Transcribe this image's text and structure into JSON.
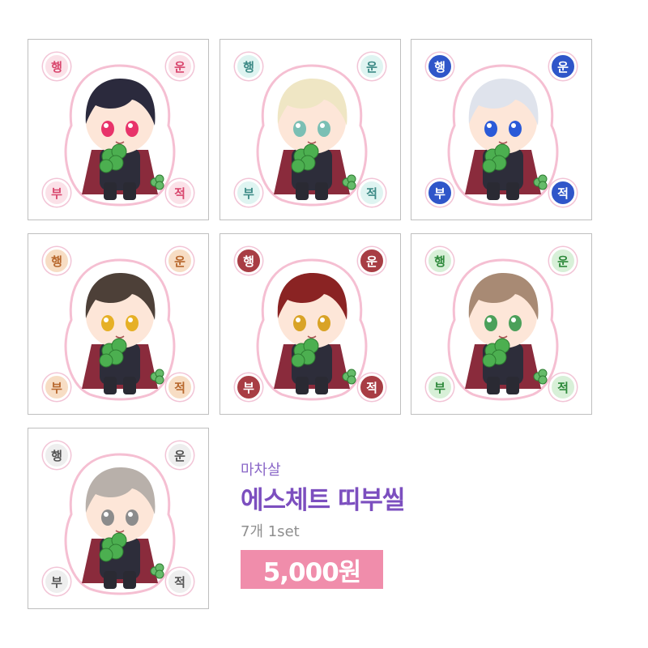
{
  "product": {
    "brand": "마차살",
    "title": "에스체트 띠부씰",
    "subtitle": "7개 1set",
    "price": "5,000원"
  },
  "badge_text": {
    "tl": "행",
    "tr": "운",
    "bl": "부",
    "br": "적"
  },
  "stickers": [
    {
      "badge_color": "#d9476e",
      "badge_bg": "#fbe1e8",
      "hair": "#2b2a3d",
      "eyes": "#e8336a"
    },
    {
      "badge_color": "#3d8a86",
      "badge_bg": "#dff4f1",
      "hair": "#efe6c4",
      "eyes": "#7bbfb4"
    },
    {
      "badge_color": "#ffffff",
      "badge_bg": "#2f56c9",
      "hair": "#dfe3ec",
      "eyes": "#2a5ad8"
    },
    {
      "badge_color": "#b8682e",
      "badge_bg": "#f7ddc4",
      "hair": "#4d4038",
      "eyes": "#e6b026"
    },
    {
      "badge_color": "#ffffff",
      "badge_bg": "#a83d44",
      "hair": "#8a2323",
      "eyes": "#d9a326"
    },
    {
      "badge_color": "#2f8a3c",
      "badge_bg": "#d8f0d8",
      "hair": "#a88a74",
      "eyes": "#4ba05a"
    },
    {
      "badge_color": "#555555",
      "badge_bg": "#eeeeee",
      "hair": "#b8b0aa",
      "eyes": "#8c8c8c"
    }
  ]
}
